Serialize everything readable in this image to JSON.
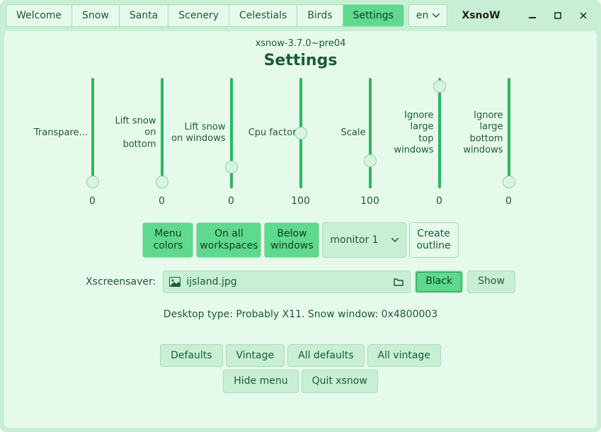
{
  "app_title": "XsnoW",
  "tabs": [
    "Welcome",
    "Snow",
    "Santa",
    "Scenery",
    "Celestials",
    "Birds",
    "Settings"
  ],
  "active_tab": "Settings",
  "lang": "en",
  "version": "xsnow-3.7.0~pre04",
  "heading": "Settings",
  "sliders": [
    {
      "label": "Transpare…",
      "value": "0",
      "pos": 1.0,
      "labelLeft": -82,
      "labelWidth": 78
    },
    {
      "label": "Lift snow\non bottom",
      "value": "0",
      "pos": 1.0,
      "labelLeft": -72,
      "labelWidth": 66
    },
    {
      "label": "Lift snow\non windows",
      "value": "0",
      "pos": 0.85,
      "labelLeft": -86,
      "labelWidth": 80
    },
    {
      "label": "Cpu factor",
      "value": "100",
      "pos": 0.5,
      "labelLeft": -76,
      "labelWidth": 72
    },
    {
      "label": "Scale",
      "value": "100",
      "pos": 0.78,
      "labelLeft": -46,
      "labelWidth": 42
    },
    {
      "label": "Ignore\nlarge\ntop\nwindows",
      "value": "0",
      "pos": 0.02,
      "labelLeft": -68,
      "labelWidth": 62
    },
    {
      "label": "Ignore\nlarge\nbottom\nwindows",
      "value": "0",
      "pos": 1.0,
      "labelLeft": -68,
      "labelWidth": 62
    }
  ],
  "toggles": {
    "menu_colors": "Menu\ncolors",
    "on_all_ws": "On all\nworkspaces",
    "below_windows": "Below\nwindows",
    "monitor": "monitor 1",
    "create_outline": "Create\noutline"
  },
  "xscreensaver": {
    "label": "Xscreensaver:",
    "file": "ijsland.jpg",
    "black": "Black",
    "show": "Show"
  },
  "desktop_info": "Desktop type: Probably X11. Snow window: 0x4800003",
  "bottom": {
    "defaults": "Defaults",
    "vintage": "Vintage",
    "all_defaults": "All defaults",
    "all_vintage": "All vintage",
    "hide_menu": "Hide menu",
    "quit": "Quit xsnow"
  }
}
